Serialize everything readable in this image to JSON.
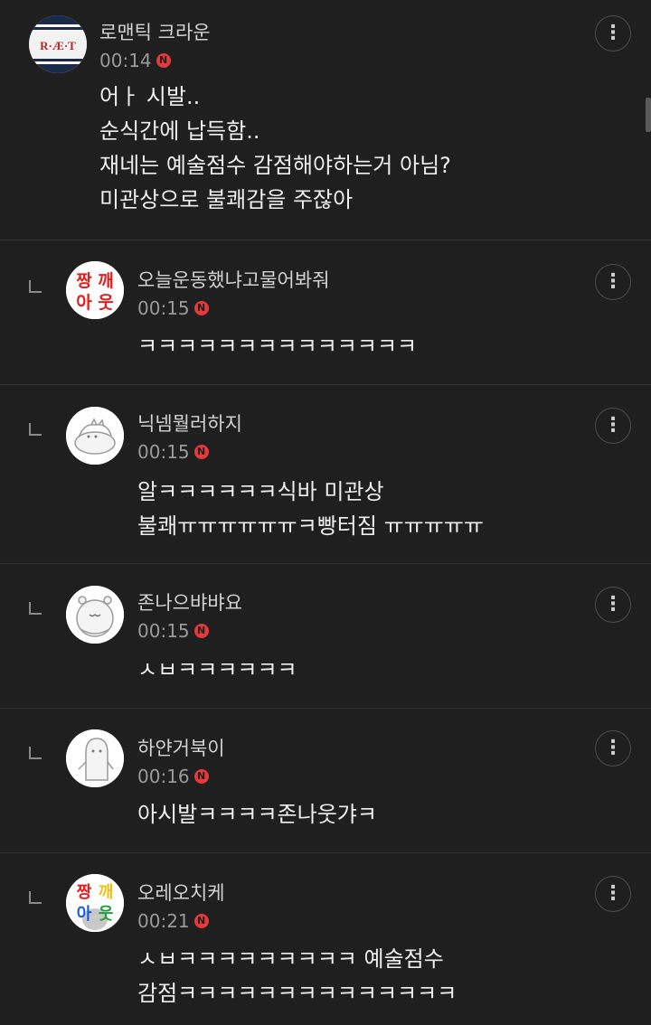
{
  "comments": [
    {
      "nickname": "로맨틱 크라운",
      "time": "00:14",
      "badge": "N",
      "text": "어ㅏ 시발..\n순식간에 납득함..\n재네는 예술점수 감점해야하는거 아님?\n미관상으로 불쾌감을 주잖아",
      "avatar_text": "R·Æ·T",
      "more": "⋮"
    },
    {
      "nickname": "오늘운동했냐고물어봐줘",
      "time": "00:15",
      "badge": "N",
      "text": "ㅋㅋㅋㅋㅋㅋㅋㅋㅋㅋㅋㅋㅋㅋ",
      "avatar_text": [
        "짱",
        "깨",
        "아",
        "웃"
      ],
      "more": "⋮"
    },
    {
      "nickname": "닉넴뭘러하지",
      "time": "00:15",
      "badge": "N",
      "text": "알ㅋㅋㅋㅋㅋㅋ식바 미관상\n불쾌ㅠㅠㅠㅠㅠㅠㅋ빵터짐 ㅠㅠㅠㅠㅠ",
      "more": "⋮"
    },
    {
      "nickname": "존나으뱌뱌요",
      "time": "00:15",
      "badge": "N",
      "text": "ㅅㅂㅋㅋㅋㅋㅋㅋ",
      "more": "⋮"
    },
    {
      "nickname": "하얀거북이",
      "time": "00:16",
      "badge": "N",
      "text": "아시발ㅋㅋㅋㅋ존나웃갸ㅋ",
      "more": "⋮"
    },
    {
      "nickname": "오레오치케",
      "time": "00:21",
      "badge": "N",
      "text": "ㅅㅂㅋㅋㅋㅋㅋㅋㅋㅋㅋ 예술점수\n감점ㅋㅋㅋㅋㅋㅋㅋㅋㅋㅋㅋㅋㅋㅋ",
      "avatar_text": [
        "짱",
        "깨",
        "아",
        "웃"
      ],
      "more": "⋮"
    }
  ],
  "colors": {
    "background": "#1f1f1f",
    "divider": "#333333",
    "badge": "#e5393c",
    "time": "#9a9a9a"
  }
}
